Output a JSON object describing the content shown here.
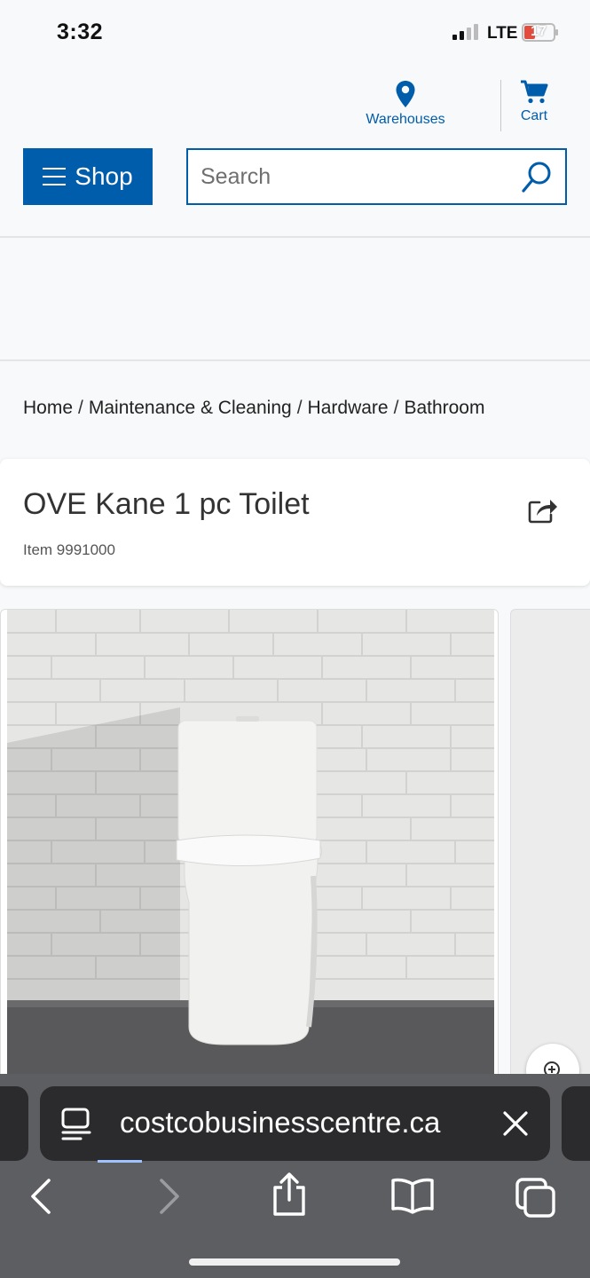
{
  "status_bar": {
    "time": "3:32",
    "network": "LTE",
    "battery": "17",
    "battery_level": 0.17
  },
  "header": {
    "warehouses_label": "Warehouses",
    "cart_label": "Cart",
    "shop_label": "Shop",
    "search_placeholder": "Search",
    "brand_color": "#005dab"
  },
  "breadcrumb": {
    "items": [
      "Home",
      "Maintenance & Cleaning",
      "Hardware",
      "Bathroom"
    ],
    "separator": "/"
  },
  "product": {
    "title": "OVE Kane 1 pc Toilet",
    "item_number": "Item 9991000",
    "image_subject": "toilet"
  },
  "browser": {
    "url": "costcobusinesscentre.ca",
    "icons": [
      "reader-mode-icon",
      "close-icon",
      "back-icon",
      "forward-icon",
      "share-icon",
      "bookmarks-icon",
      "tabs-icon"
    ]
  }
}
